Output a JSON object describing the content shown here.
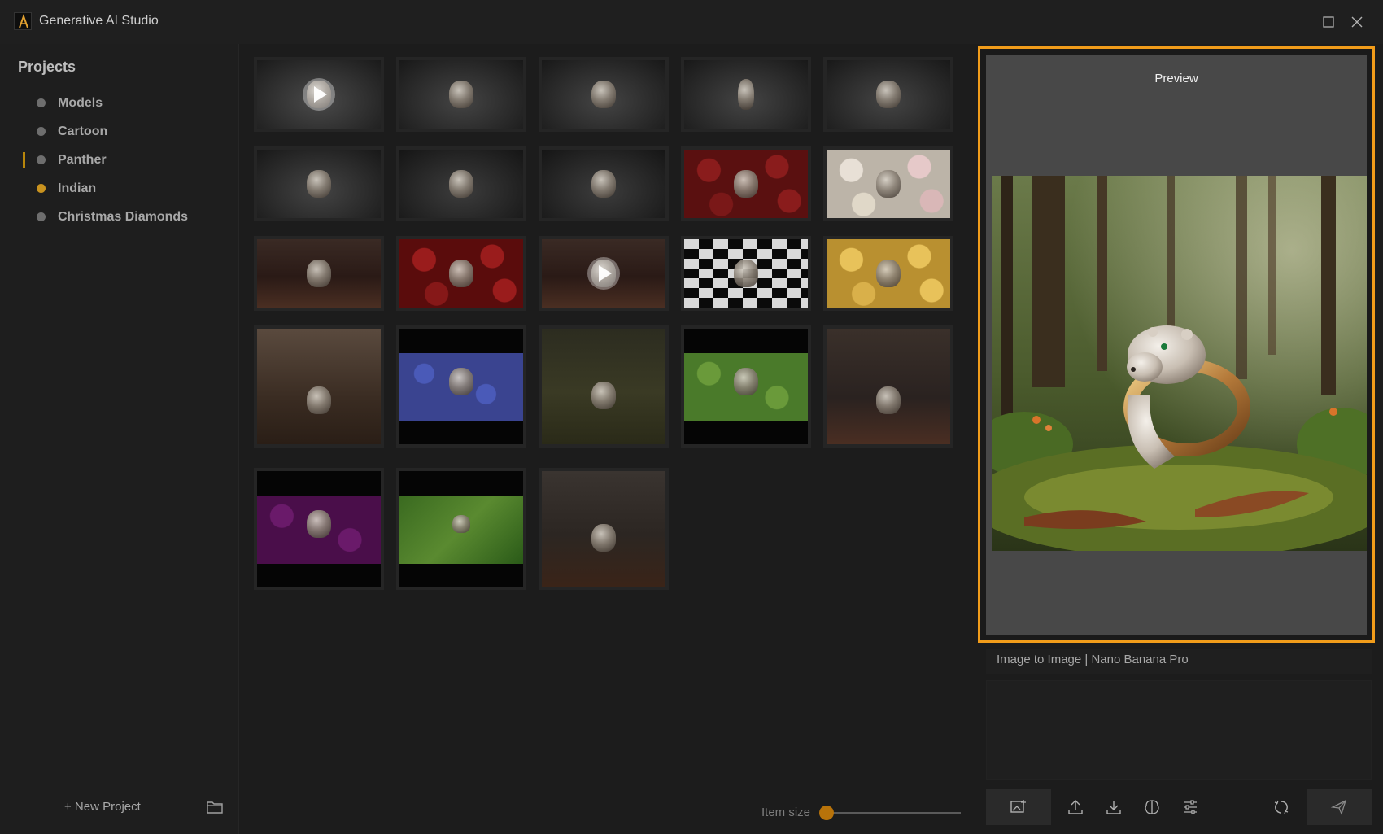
{
  "window": {
    "title": "Generative AI Studio"
  },
  "sidebar": {
    "heading": "Projects",
    "items": [
      {
        "label": "Models",
        "state": "default"
      },
      {
        "label": "Cartoon",
        "state": "default"
      },
      {
        "label": "Panther",
        "state": "active"
      },
      {
        "label": "Indian",
        "state": "highlighted"
      },
      {
        "label": "Christmas Diamonds",
        "state": "default"
      }
    ],
    "new_project_label": "+ New Project"
  },
  "gallery": {
    "thumbnails": [
      {
        "scene": "dark studio",
        "video": true
      },
      {
        "scene": "dark studio",
        "video": false
      },
      {
        "scene": "dark studio",
        "video": false
      },
      {
        "scene": "dark studio",
        "video": false
      },
      {
        "scene": "dark studio",
        "video": false
      },
      {
        "scene": "dark studio",
        "video": false
      },
      {
        "scene": "dark studio",
        "video": false
      },
      {
        "scene": "dark studio",
        "video": false
      },
      {
        "scene": "red roses",
        "video": false
      },
      {
        "scene": "white roses",
        "video": false
      },
      {
        "scene": "wood table",
        "video": false
      },
      {
        "scene": "red roses",
        "video": false
      },
      {
        "scene": "wood table",
        "video": true
      },
      {
        "scene": "checkerboard",
        "video": false
      },
      {
        "scene": "yellow roses",
        "video": false
      },
      {
        "scene": "showcase",
        "video": false
      },
      {
        "scene": "blue hydrangea",
        "video": false
      },
      {
        "scene": "forest",
        "video": false
      },
      {
        "scene": "green succulents",
        "video": false
      },
      {
        "scene": "jewelry display",
        "video": false
      },
      {
        "scene": "purple roses",
        "video": false
      },
      {
        "scene": "green leaves",
        "video": false
      },
      {
        "scene": "autumn forest",
        "video": false
      }
    ],
    "item_size_label": "Item size",
    "item_size_value": 0
  },
  "preview": {
    "title": "Preview"
  },
  "generation": {
    "mode_text": "Image to Image | Nano Banana Pro",
    "prompt_value": ""
  },
  "colors": {
    "accent": "#f19c1a",
    "active_indicator": "#b8860b",
    "slider_knob": "#b8730a"
  }
}
